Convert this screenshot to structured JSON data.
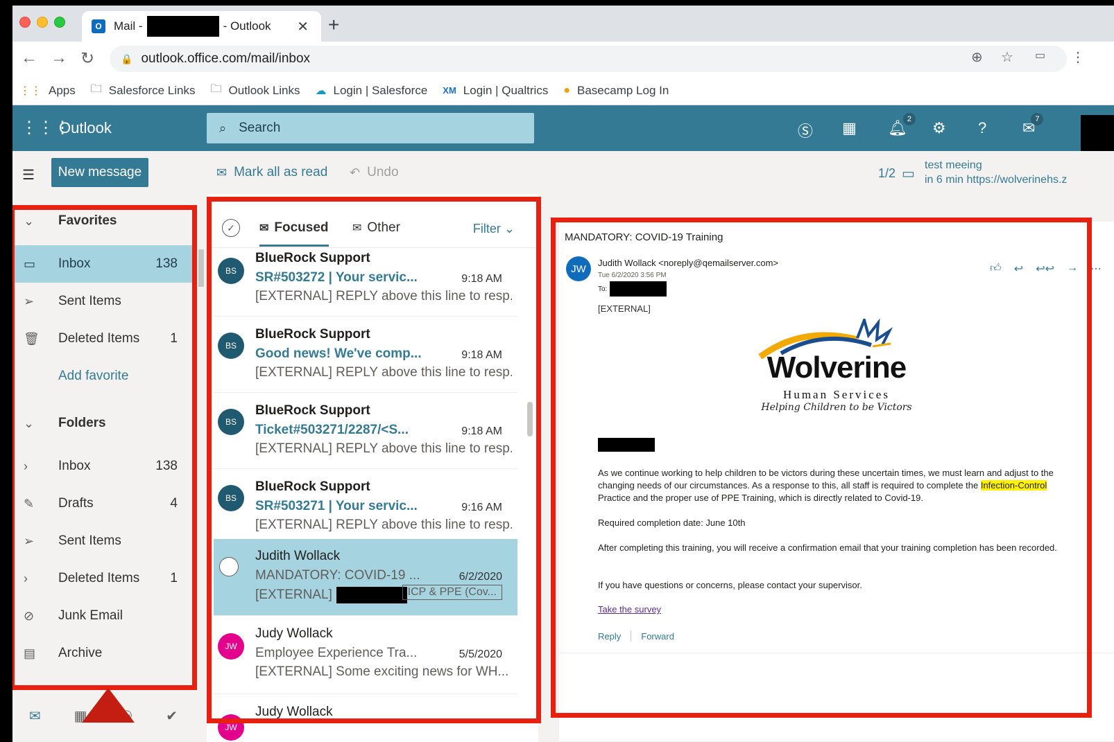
{
  "browser": {
    "tab_title_prefix": "Mail -",
    "tab_title_suffix": "- Outlook",
    "tab_close": "✕",
    "new_tab": "+",
    "url": "outlook.office.com/mail/inbox",
    "bookmarks": [
      {
        "label": "Apps",
        "icon": "apps-grid-icon"
      },
      {
        "label": "Salesforce Links",
        "icon": "folder-icon"
      },
      {
        "label": "Outlook Links",
        "icon": "folder-icon"
      },
      {
        "label": "Login | Salesforce",
        "icon": "salesforce-cloud-icon"
      },
      {
        "label": "Login | Qualtrics",
        "icon": "qualtrics-xm-icon"
      },
      {
        "label": "Basecamp Log In",
        "icon": "basecamp-icon"
      }
    ]
  },
  "header": {
    "app_name": "Outlook",
    "search_placeholder": "Search",
    "notification_badge": "2",
    "feedback_badge": "7"
  },
  "command_bar": {
    "new_message": "New message",
    "mark_all_read": "Mark all as read",
    "undo": "Undo",
    "reminder_count": "1/2",
    "reminder_title": "test meeing",
    "reminder_detail": "in 6 min https://wolverinehs.z"
  },
  "nav": {
    "favorites_header": "Favorites",
    "favorites": [
      {
        "label": "Inbox",
        "count": "138"
      },
      {
        "label": "Sent Items",
        "count": ""
      },
      {
        "label": "Deleted Items",
        "count": "1"
      }
    ],
    "add_favorite": "Add favorite",
    "folders_header": "Folders",
    "folders": [
      {
        "label": "Inbox",
        "count": "138"
      },
      {
        "label": "Drafts",
        "count": "4"
      },
      {
        "label": "Sent Items",
        "count": ""
      },
      {
        "label": "Deleted Items",
        "count": "1"
      },
      {
        "label": "Junk Email",
        "count": ""
      },
      {
        "label": "Archive",
        "count": ""
      }
    ]
  },
  "message_list": {
    "tab_focused": "Focused",
    "tab_other": "Other",
    "filter": "Filter",
    "messages": [
      {
        "initials": "BS",
        "sender": "BlueRock Support",
        "subject": "SR#503272 | Your servic...",
        "time": "9:18 AM",
        "preview": "[EXTERNAL] REPLY above this line to resp..."
      },
      {
        "initials": "BS",
        "sender": "BlueRock Support",
        "subject": "Good news! We've comp...",
        "time": "9:18 AM",
        "preview": "[EXTERNAL] REPLY above this line to resp..."
      },
      {
        "initials": "BS",
        "sender": "BlueRock Support",
        "subject": "Ticket#503271/2287/<S...",
        "time": "9:18 AM",
        "preview": "[EXTERNAL] REPLY above this line to resp..."
      },
      {
        "initials": "BS",
        "sender": "BlueRock Support",
        "subject": "SR#503271 | Your servic...",
        "time": "9:16 AM",
        "preview": "[EXTERNAL] REPLY above this line to resp..."
      },
      {
        "initials": "",
        "sender": "Judith Wollack",
        "subject": "MANDATORY: COVID-19 ...",
        "time": "6/2/2020",
        "preview": "[EXTERNAL]",
        "tag": "ICP & PPE (Cov..."
      },
      {
        "initials": "JW",
        "sender": "Judy Wollack",
        "subject": "Employee Experience Tra...",
        "time": "5/5/2020",
        "preview": "[EXTERNAL] Some exciting news for WH..."
      },
      {
        "initials": "JW",
        "sender": "Judy Wollack",
        "subject": "",
        "time": "",
        "preview": ""
      }
    ]
  },
  "reading_pane": {
    "subject": "MANDATORY: COVID-19 Training",
    "avatar_initials": "JW",
    "from": "Judith Wollack <noreply@qemailserver.com>",
    "date": "Tue 6/2/2020 3:56 PM",
    "to_label": "To:",
    "external_tag": "[EXTERNAL]",
    "logo_name": "Wolverine",
    "logo_sub": "Human Services",
    "logo_tagline": "Helping Children to be Victors",
    "para1_a": "As we continue working to help children to be victors during these uncertain times, we must learn and adjust to the changing needs of our circumstances. As a response to this, all staff is required to complete the ",
    "para1_hl": "Infection-Control",
    "para1_b": " Practice and the proper use of PPE Training, which is directly related to Covid-19.",
    "para2": "Required completion date: June 10th",
    "para3": "After completing this training, you will receive a confirmation email that your training completion has been recorded.",
    "para4": "If you have questions or concerns, please contact your supervisor.",
    "survey_link": "Take the survey",
    "reply": "Reply",
    "forward": "Forward"
  },
  "colors": {
    "accent": "#357a94",
    "annotation_red": "#e8200f",
    "selected_bg": "#a6d3e0"
  }
}
